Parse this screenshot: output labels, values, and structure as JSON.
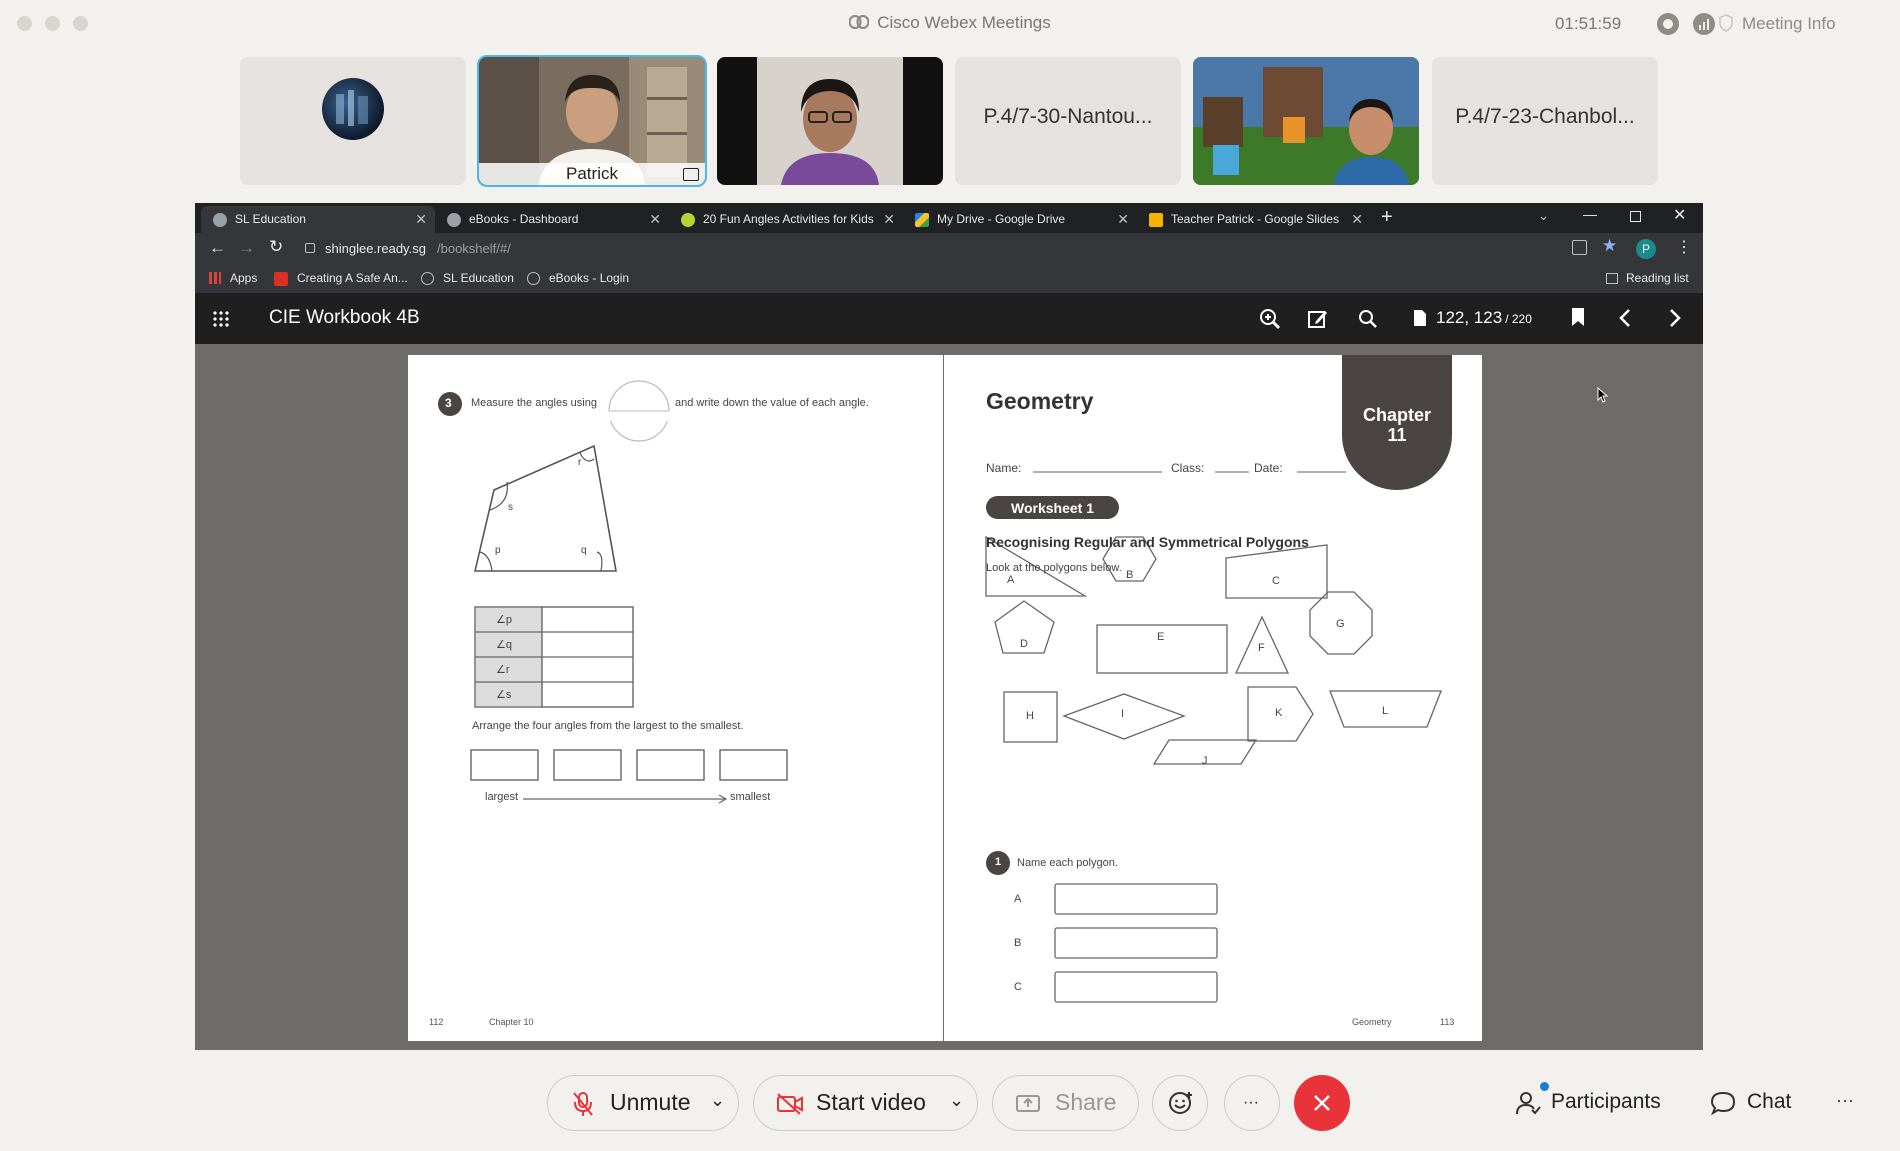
{
  "window": {
    "app_title": "Cisco Webex Meetings",
    "timer": "01:51:59",
    "meeting_info": "Meeting Info"
  },
  "participants": [
    {
      "name": "",
      "kind": "avatar"
    },
    {
      "name": "Patrick",
      "kind": "video",
      "selected": true
    },
    {
      "name": "",
      "kind": "video"
    },
    {
      "name": "P.4/7-30-Nantou...",
      "kind": "name"
    },
    {
      "name": "",
      "kind": "video"
    },
    {
      "name": "P.4/7-23-Chanbol...",
      "kind": "name"
    }
  ],
  "browser": {
    "tabs": [
      {
        "label": "SL Education",
        "active": true
      },
      {
        "label": "eBooks - Dashboard"
      },
      {
        "label": "20 Fun Angles Activities for Kids"
      },
      {
        "label": "My Drive - Google Drive"
      },
      {
        "label": "Teacher Patrick - Google Slides"
      }
    ],
    "url_host": "shinglee.ready.sg",
    "url_path": "/bookshelf/#/",
    "avatar_letter": "P",
    "bookmarks": [
      "Apps",
      "Creating A Safe An...",
      "SL Education",
      "eBooks - Login"
    ],
    "reading_list": "Reading list"
  },
  "reader": {
    "book_title": "CIE Workbook 4B",
    "pages_current": "122, 123",
    "pages_total": "/ 220"
  },
  "left_page": {
    "q_number": "3",
    "q_text_a": "Measure the angles using",
    "q_text_b": "and write down the value of each angle.",
    "angle_labels": [
      "r",
      "s",
      "p",
      "q"
    ],
    "table_rows": [
      "∠p",
      "∠q",
      "∠r",
      "∠s"
    ],
    "arrange_text": "Arrange the four angles from the largest to the smallest.",
    "largest": "largest",
    "smallest": "smallest",
    "footer_page": "112",
    "footer_chapter": "Chapter 10"
  },
  "right_page": {
    "heading": "Geometry",
    "chapter_word": "Chapter",
    "chapter_num": "11",
    "name_label": "Name:",
    "class_label": "Class:",
    "date_label": "Date:",
    "worksheet": "Worksheet 1",
    "subtitle": "Recognising Regular and Symmetrical Polygons",
    "instruction": "Look at the polygons below.",
    "shapes": [
      "A",
      "B",
      "C",
      "D",
      "E",
      "F",
      "G",
      "H",
      "I",
      "J",
      "K",
      "L"
    ],
    "q1_number": "1",
    "q1_text": "Name each polygon.",
    "answers": [
      "A",
      "B",
      "C"
    ],
    "footer_title": "Geometry",
    "footer_page": "113"
  },
  "controls": {
    "unmute": "Unmute",
    "start_video": "Start video",
    "share": "Share",
    "more": "···",
    "participants": "Participants",
    "chat": "Chat",
    "overflow": "···"
  },
  "colors": {
    "accent_blue": "#4ab8e8",
    "end_red": "#e8333b",
    "mute_red": "#e8333b"
  }
}
